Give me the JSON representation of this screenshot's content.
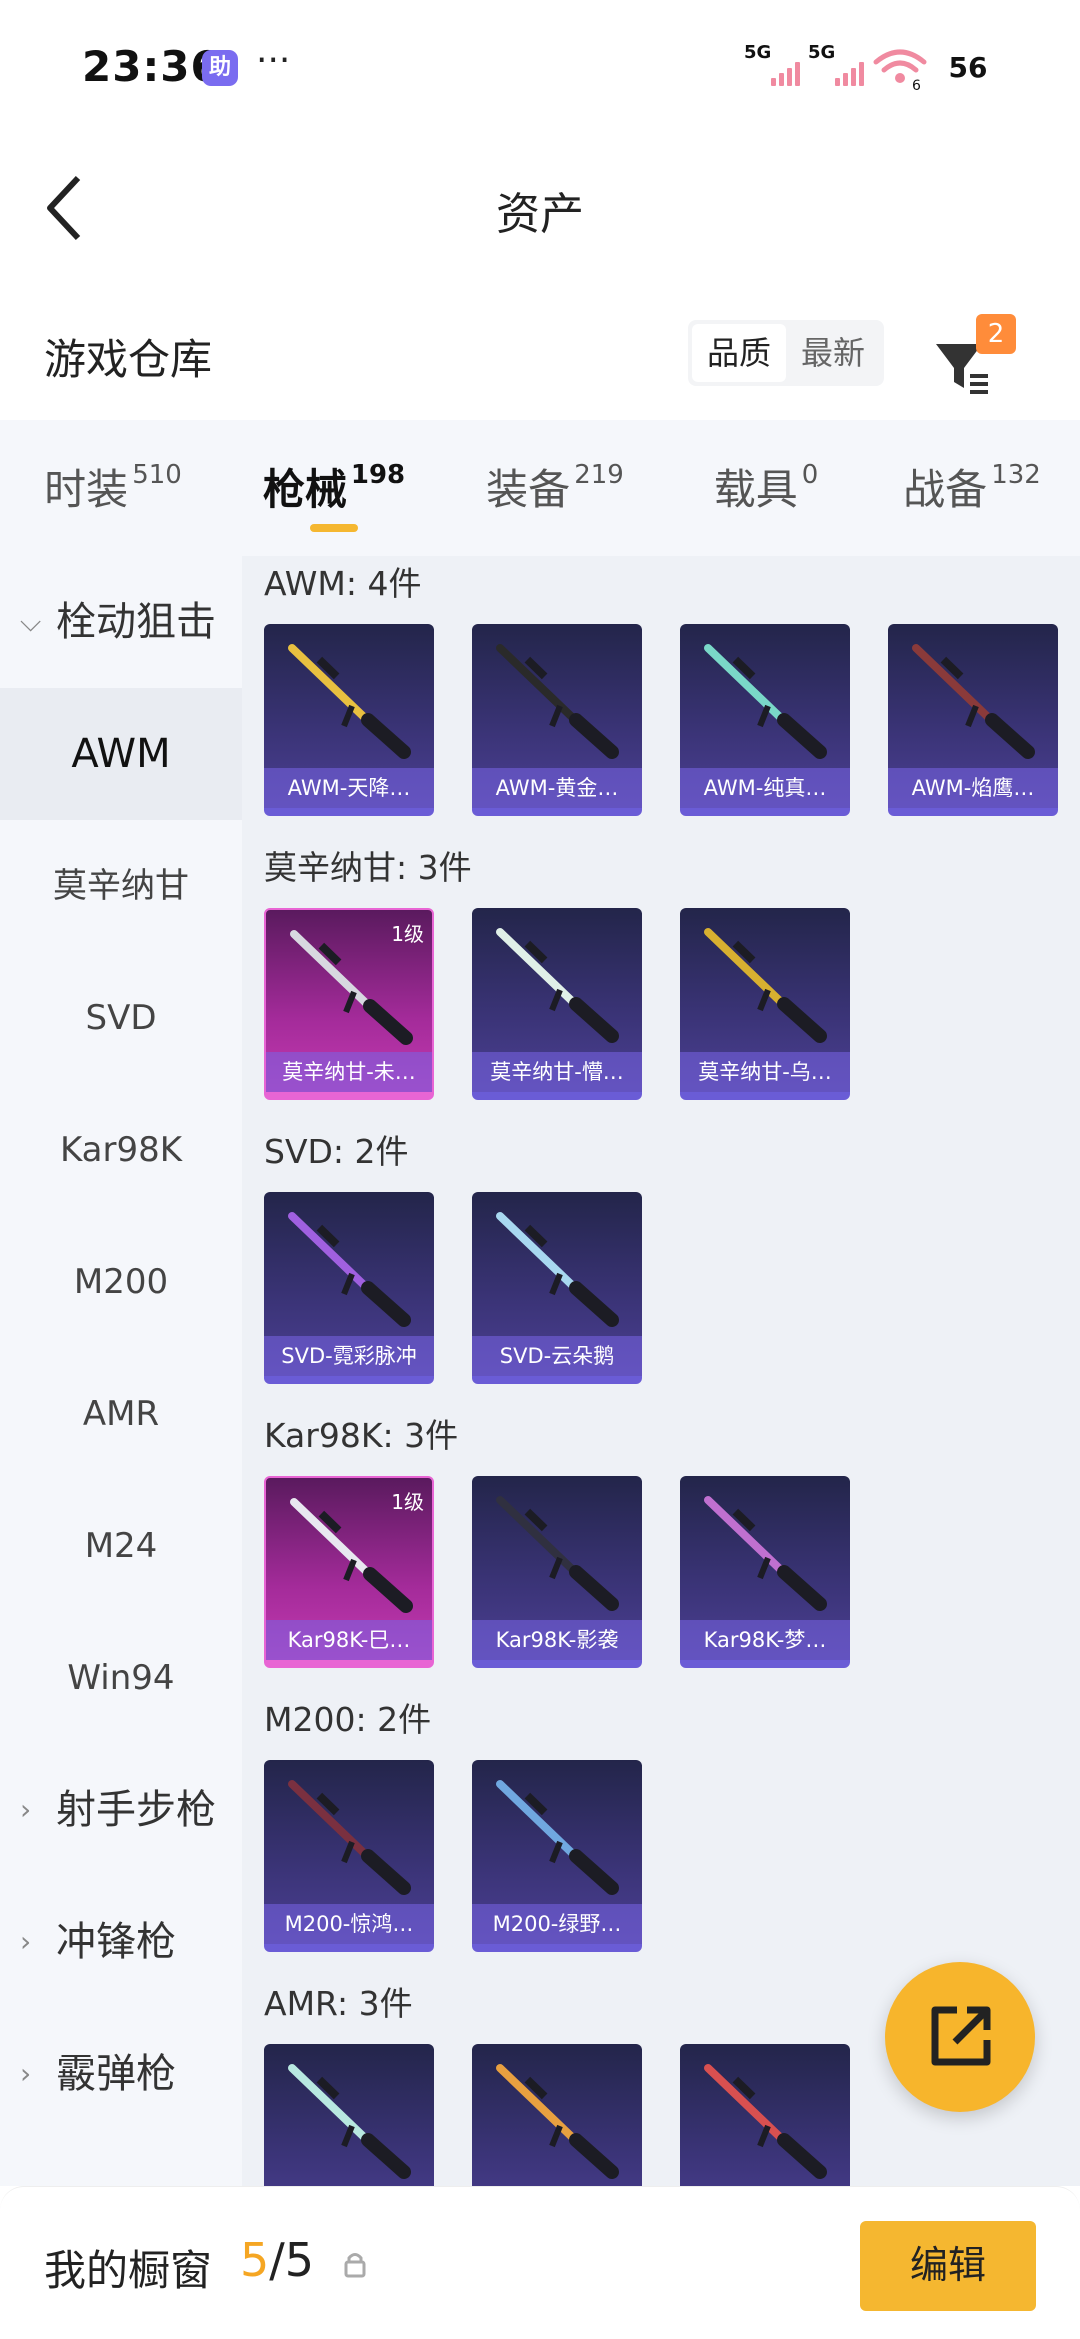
{
  "status": {
    "time": "23:36",
    "app_badge": "助",
    "dots": "···",
    "sig1": "5G",
    "sig2": "5G",
    "wifi_num": "6",
    "battery": "56"
  },
  "header": {
    "title": "资产"
  },
  "repo": {
    "name": "游戏仓库",
    "sort_quality": "品质",
    "sort_newest": "最新",
    "filter_count": "2"
  },
  "tabs": [
    {
      "label": "时装",
      "count": "510"
    },
    {
      "label": "枪械",
      "count": "198"
    },
    {
      "label": "装备",
      "count": "219"
    },
    {
      "label": "载具",
      "count": "0"
    },
    {
      "label": "战备",
      "count": "132"
    }
  ],
  "sidebar": [
    {
      "label": "栓动狙击",
      "icon": "chevron-down-icon"
    },
    {
      "label": "AWM"
    },
    {
      "label": "莫辛纳甘"
    },
    {
      "label": "SVD"
    },
    {
      "label": "Kar98K"
    },
    {
      "label": "M200"
    },
    {
      "label": "AMR"
    },
    {
      "label": "M24"
    },
    {
      "label": "Win94"
    },
    {
      "label": "射手步枪",
      "icon": "chevron-right-icon"
    },
    {
      "label": "冲锋枪",
      "icon": "chevron-right-icon"
    },
    {
      "label": "霰弹枪",
      "icon": "chevron-right-icon"
    }
  ],
  "sections": [
    {
      "title": "AWM: 4件",
      "items": [
        {
          "name": "AWM-天降…",
          "color": "#e8c040"
        },
        {
          "name": "AWM-黄金…",
          "color": "#2a2a2a"
        },
        {
          "name": "AWM-纯真…",
          "color": "#7ad8c8"
        },
        {
          "name": "AWM-焰鹰…",
          "color": "#8a3a3a"
        }
      ]
    },
    {
      "title": "莫辛纳甘: 3件",
      "items": [
        {
          "name": "莫辛纳甘-未…",
          "color": "#d8d8e0",
          "level": "1级",
          "rare": true
        },
        {
          "name": "莫辛纳甘-懵…",
          "color": "#e0f0e8"
        },
        {
          "name": "莫辛纳甘-乌…",
          "color": "#d8b030"
        }
      ]
    },
    {
      "title": "SVD: 2件",
      "items": [
        {
          "name": "SVD-霓彩脉冲",
          "color": "#a060e0"
        },
        {
          "name": "SVD-云朵鹅",
          "color": "#a8d8f0"
        }
      ]
    },
    {
      "title": "Kar98K: 3件",
      "items": [
        {
          "name": "Kar98K-巳…",
          "color": "#e8e8f0",
          "level": "1级",
          "rare": true
        },
        {
          "name": "Kar98K-影袭",
          "color": "#303040"
        },
        {
          "name": "Kar98K-梦…",
          "color": "#c070d0"
        }
      ]
    },
    {
      "title": "M200: 2件",
      "items": [
        {
          "name": "M200-惊鸿…",
          "color": "#7a3040"
        },
        {
          "name": "M200-绿野…",
          "color": "#70a8e0"
        }
      ]
    },
    {
      "title": "AMR: 3件",
      "items": [
        {
          "name": "",
          "color": "#b8e8e0"
        },
        {
          "name": "",
          "color": "#e8a040"
        },
        {
          "name": "",
          "color": "#d85050"
        }
      ]
    }
  ],
  "bottom": {
    "label": "我的橱窗",
    "current": "5",
    "separator": "/",
    "total": "5",
    "edit": "编辑"
  }
}
